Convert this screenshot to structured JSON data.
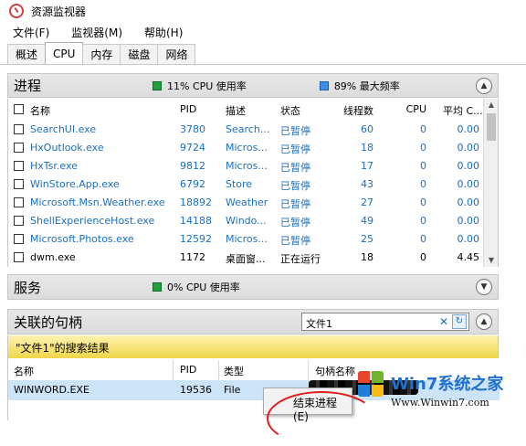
{
  "window": {
    "title": "资源监视器"
  },
  "menu": [
    "文件(F)",
    "监视器(M)",
    "帮助(H)"
  ],
  "tabs": [
    "概述",
    "CPU",
    "内存",
    "磁盘",
    "网络"
  ],
  "active_tab": "CPU",
  "process_section": {
    "title": "进程",
    "cpu_usage": "11% CPU 使用率",
    "max_freq": "89% 最大频率",
    "columns": [
      "名称",
      "PID",
      "描述",
      "状态",
      "线程数",
      "CPU",
      "平均 C..."
    ],
    "rows": [
      {
        "name": "SearchUI.exe",
        "pid": "3780",
        "desc": "Search...",
        "status": "已暂停",
        "threads": "60",
        "cpu": "0",
        "avg": "0.00"
      },
      {
        "name": "HxOutlook.exe",
        "pid": "9724",
        "desc": "Micros...",
        "status": "已暂停",
        "threads": "18",
        "cpu": "0",
        "avg": "0.00"
      },
      {
        "name": "HxTsr.exe",
        "pid": "9812",
        "desc": "Micros...",
        "status": "已暂停",
        "threads": "17",
        "cpu": "0",
        "avg": "0.00"
      },
      {
        "name": "WinStore.App.exe",
        "pid": "6792",
        "desc": "Store",
        "status": "已暂停",
        "threads": "43",
        "cpu": "0",
        "avg": "0.00"
      },
      {
        "name": "Microsoft.Msn.Weather.exe",
        "pid": "18892",
        "desc": "Weather",
        "status": "已暂停",
        "threads": "27",
        "cpu": "0",
        "avg": "0.00"
      },
      {
        "name": "ShellExperienceHost.exe",
        "pid": "14188",
        "desc": "Windo...",
        "status": "已暂停",
        "threads": "49",
        "cpu": "0",
        "avg": "0.00"
      },
      {
        "name": "Microsoft.Photos.exe",
        "pid": "12592",
        "desc": "Micros...",
        "status": "已暂停",
        "threads": "25",
        "cpu": "0",
        "avg": "0.00"
      },
      {
        "name": "dwm.exe",
        "pid": "1172",
        "desc": "桌面窗...",
        "status": "正在运行",
        "threads": "18",
        "cpu": "0",
        "avg": "4.45"
      }
    ]
  },
  "services_section": {
    "title": "服务",
    "cpu_usage": "0% CPU 使用率"
  },
  "handles_section": {
    "title": "关联的句柄",
    "search_value": "文件1",
    "result_banner": "\"文件1\"的搜索结果",
    "columns": [
      "名称",
      "PID",
      "类型",
      "句柄名称"
    ],
    "rows": [
      {
        "name": "WINWORD.EXE",
        "pid": "19536",
        "type": "File"
      }
    ]
  },
  "context_menu": {
    "item": "结束进程(E)"
  },
  "watermark": {
    "main": "Win7系统之家",
    "url": "Www.Winwin7.com"
  },
  "colors": {
    "accent_link": "#1a6fc0",
    "banner": "#f1d64a",
    "selected_row": "#cce4f7",
    "cpu_green": "#1ea23b",
    "freq_blue": "#3c8ee6"
  }
}
